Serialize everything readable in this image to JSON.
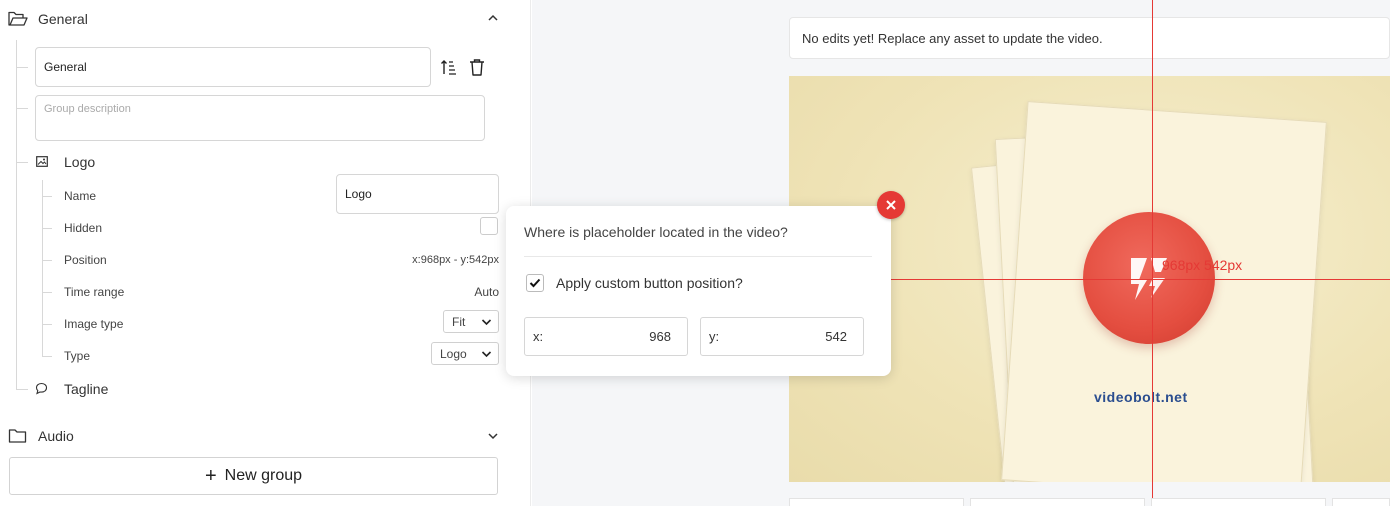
{
  "sidebar": {
    "general": {
      "title": "General",
      "name_value": "General",
      "description_placeholder": "Group description",
      "logo": {
        "title": "Logo",
        "rows": {
          "name": {
            "label": "Name",
            "value": "Logo"
          },
          "hidden": {
            "label": "Hidden"
          },
          "position": {
            "label": "Position",
            "value": "x:968px - y:542px"
          },
          "time_range": {
            "label": "Time range",
            "value": "Auto"
          },
          "image_type": {
            "label": "Image type",
            "value": "Fit"
          },
          "type": {
            "label": "Type",
            "value": "Logo"
          }
        }
      },
      "tagline": {
        "title": "Tagline"
      }
    },
    "audio": {
      "title": "Audio"
    },
    "new_group_label": "New group"
  },
  "preview": {
    "notice": "No edits yet! Replace any asset to update the video.",
    "brand_text": "videobolt.net",
    "crosshair_label": "968px 542px"
  },
  "popup": {
    "title": "Where is placeholder located in the video?",
    "checkbox_label": "Apply custom button position?",
    "checkbox_checked": true,
    "x": {
      "label": "x:",
      "value": "968"
    },
    "y": {
      "label": "y:",
      "value": "542"
    }
  },
  "colors": {
    "accent_red": "#e53935",
    "brand_blue": "#2a4d8f"
  }
}
